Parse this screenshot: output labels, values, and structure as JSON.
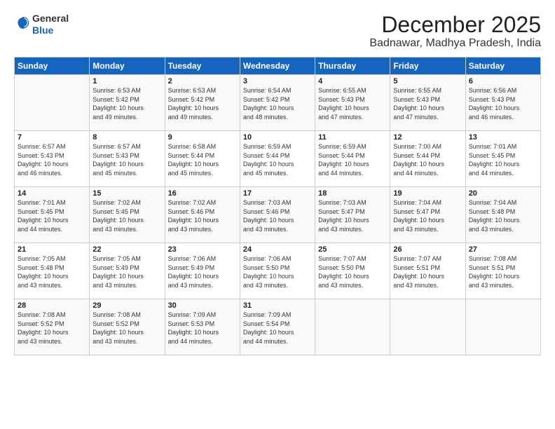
{
  "header": {
    "logo_line1": "General",
    "logo_line2": "Blue",
    "month": "December 2025",
    "location": "Badnawar, Madhya Pradesh, India"
  },
  "weekdays": [
    "Sunday",
    "Monday",
    "Tuesday",
    "Wednesday",
    "Thursday",
    "Friday",
    "Saturday"
  ],
  "weeks": [
    [
      {
        "day": "",
        "info": ""
      },
      {
        "day": "1",
        "info": "Sunrise: 6:53 AM\nSunset: 5:42 PM\nDaylight: 10 hours\nand 49 minutes."
      },
      {
        "day": "2",
        "info": "Sunrise: 6:53 AM\nSunset: 5:42 PM\nDaylight: 10 hours\nand 49 minutes."
      },
      {
        "day": "3",
        "info": "Sunrise: 6:54 AM\nSunset: 5:42 PM\nDaylight: 10 hours\nand 48 minutes."
      },
      {
        "day": "4",
        "info": "Sunrise: 6:55 AM\nSunset: 5:43 PM\nDaylight: 10 hours\nand 47 minutes."
      },
      {
        "day": "5",
        "info": "Sunrise: 6:55 AM\nSunset: 5:43 PM\nDaylight: 10 hours\nand 47 minutes."
      },
      {
        "day": "6",
        "info": "Sunrise: 6:56 AM\nSunset: 5:43 PM\nDaylight: 10 hours\nand 46 minutes."
      }
    ],
    [
      {
        "day": "7",
        "info": "Sunrise: 6:57 AM\nSunset: 5:43 PM\nDaylight: 10 hours\nand 46 minutes."
      },
      {
        "day": "8",
        "info": "Sunrise: 6:57 AM\nSunset: 5:43 PM\nDaylight: 10 hours\nand 45 minutes."
      },
      {
        "day": "9",
        "info": "Sunrise: 6:58 AM\nSunset: 5:44 PM\nDaylight: 10 hours\nand 45 minutes."
      },
      {
        "day": "10",
        "info": "Sunrise: 6:59 AM\nSunset: 5:44 PM\nDaylight: 10 hours\nand 45 minutes."
      },
      {
        "day": "11",
        "info": "Sunrise: 6:59 AM\nSunset: 5:44 PM\nDaylight: 10 hours\nand 44 minutes."
      },
      {
        "day": "12",
        "info": "Sunrise: 7:00 AM\nSunset: 5:44 PM\nDaylight: 10 hours\nand 44 minutes."
      },
      {
        "day": "13",
        "info": "Sunrise: 7:01 AM\nSunset: 5:45 PM\nDaylight: 10 hours\nand 44 minutes."
      }
    ],
    [
      {
        "day": "14",
        "info": "Sunrise: 7:01 AM\nSunset: 5:45 PM\nDaylight: 10 hours\nand 44 minutes."
      },
      {
        "day": "15",
        "info": "Sunrise: 7:02 AM\nSunset: 5:45 PM\nDaylight: 10 hours\nand 43 minutes."
      },
      {
        "day": "16",
        "info": "Sunrise: 7:02 AM\nSunset: 5:46 PM\nDaylight: 10 hours\nand 43 minutes."
      },
      {
        "day": "17",
        "info": "Sunrise: 7:03 AM\nSunset: 5:46 PM\nDaylight: 10 hours\nand 43 minutes."
      },
      {
        "day": "18",
        "info": "Sunrise: 7:03 AM\nSunset: 5:47 PM\nDaylight: 10 hours\nand 43 minutes."
      },
      {
        "day": "19",
        "info": "Sunrise: 7:04 AM\nSunset: 5:47 PM\nDaylight: 10 hours\nand 43 minutes."
      },
      {
        "day": "20",
        "info": "Sunrise: 7:04 AM\nSunset: 5:48 PM\nDaylight: 10 hours\nand 43 minutes."
      }
    ],
    [
      {
        "day": "21",
        "info": "Sunrise: 7:05 AM\nSunset: 5:48 PM\nDaylight: 10 hours\nand 43 minutes."
      },
      {
        "day": "22",
        "info": "Sunrise: 7:05 AM\nSunset: 5:49 PM\nDaylight: 10 hours\nand 43 minutes."
      },
      {
        "day": "23",
        "info": "Sunrise: 7:06 AM\nSunset: 5:49 PM\nDaylight: 10 hours\nand 43 minutes."
      },
      {
        "day": "24",
        "info": "Sunrise: 7:06 AM\nSunset: 5:50 PM\nDaylight: 10 hours\nand 43 minutes."
      },
      {
        "day": "25",
        "info": "Sunrise: 7:07 AM\nSunset: 5:50 PM\nDaylight: 10 hours\nand 43 minutes."
      },
      {
        "day": "26",
        "info": "Sunrise: 7:07 AM\nSunset: 5:51 PM\nDaylight: 10 hours\nand 43 minutes."
      },
      {
        "day": "27",
        "info": "Sunrise: 7:08 AM\nSunset: 5:51 PM\nDaylight: 10 hours\nand 43 minutes."
      }
    ],
    [
      {
        "day": "28",
        "info": "Sunrise: 7:08 AM\nSunset: 5:52 PM\nDaylight: 10 hours\nand 43 minutes."
      },
      {
        "day": "29",
        "info": "Sunrise: 7:08 AM\nSunset: 5:52 PM\nDaylight: 10 hours\nand 43 minutes."
      },
      {
        "day": "30",
        "info": "Sunrise: 7:09 AM\nSunset: 5:53 PM\nDaylight: 10 hours\nand 44 minutes."
      },
      {
        "day": "31",
        "info": "Sunrise: 7:09 AM\nSunset: 5:54 PM\nDaylight: 10 hours\nand 44 minutes."
      },
      {
        "day": "",
        "info": ""
      },
      {
        "day": "",
        "info": ""
      },
      {
        "day": "",
        "info": ""
      }
    ]
  ]
}
